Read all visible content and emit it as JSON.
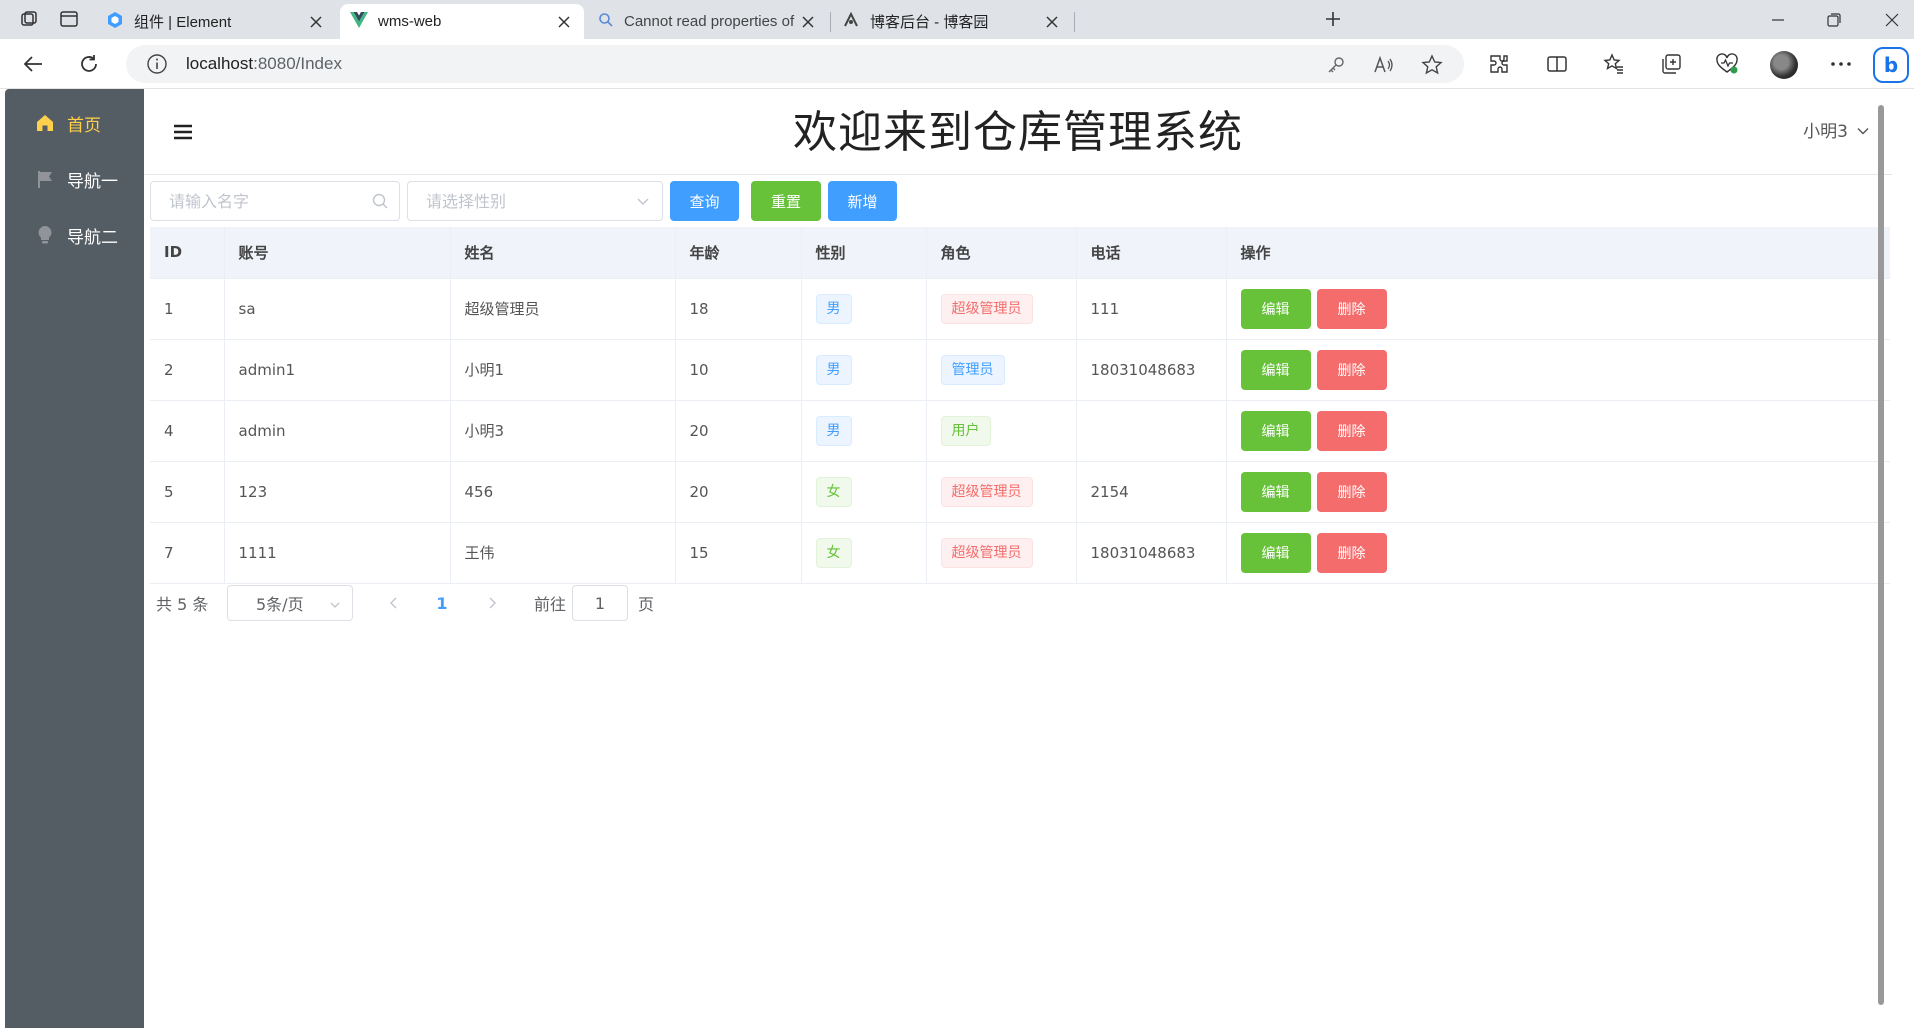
{
  "browser": {
    "tabs": [
      {
        "title": "组件 | Element"
      },
      {
        "title": "wms-web"
      },
      {
        "title": "Cannot read properties of undefi"
      },
      {
        "title": "博客后台 - 博客园"
      }
    ],
    "url_host": "localhost",
    "url_path": ":8080/Index"
  },
  "sidebar": {
    "items": [
      {
        "label": "首页",
        "icon": "home-icon"
      },
      {
        "label": "导航一",
        "icon": "flag-icon"
      },
      {
        "label": "导航二",
        "icon": "bulb-icon"
      }
    ]
  },
  "header": {
    "title": "欢迎来到仓库管理系统",
    "user": "小明3"
  },
  "toolbar": {
    "name_placeholder": "请输入名字",
    "sex_placeholder": "请选择性别",
    "query_label": "查询",
    "reset_label": "重置",
    "add_label": "新增"
  },
  "table": {
    "columns": [
      "ID",
      "账号",
      "姓名",
      "年龄",
      "性别",
      "角色",
      "电话",
      "操作"
    ],
    "rows": [
      {
        "id": "1",
        "account": "sa",
        "name": "超级管理员",
        "age": "18",
        "sex": "男",
        "role": "超级管理员",
        "phone": "111"
      },
      {
        "id": "2",
        "account": "admin1",
        "name": "小明1",
        "age": "10",
        "sex": "男",
        "role": "管理员",
        "phone": "18031048683"
      },
      {
        "id": "4",
        "account": "admin",
        "name": "小明3",
        "age": "20",
        "sex": "男",
        "role": "用户",
        "phone": ""
      },
      {
        "id": "5",
        "account": "123",
        "name": "456",
        "age": "20",
        "sex": "女",
        "role": "超级管理员",
        "phone": "2154"
      },
      {
        "id": "7",
        "account": "1111",
        "name": "王伟",
        "age": "15",
        "sex": "女",
        "role": "超级管理员",
        "phone": "18031048683"
      }
    ],
    "edit_label": "编辑",
    "delete_label": "删除"
  },
  "pagination": {
    "total": "共 5 条",
    "page_size": "5条/页",
    "current_page": "1",
    "goto_label": "前往",
    "goto_value": "1",
    "page_unit": "页"
  },
  "colors": {
    "sidebar_bg": "#545c64",
    "sidebar_active": "#ffd04b",
    "primary": "#409eff",
    "success": "#67c23a",
    "danger": "#f56c6c"
  }
}
